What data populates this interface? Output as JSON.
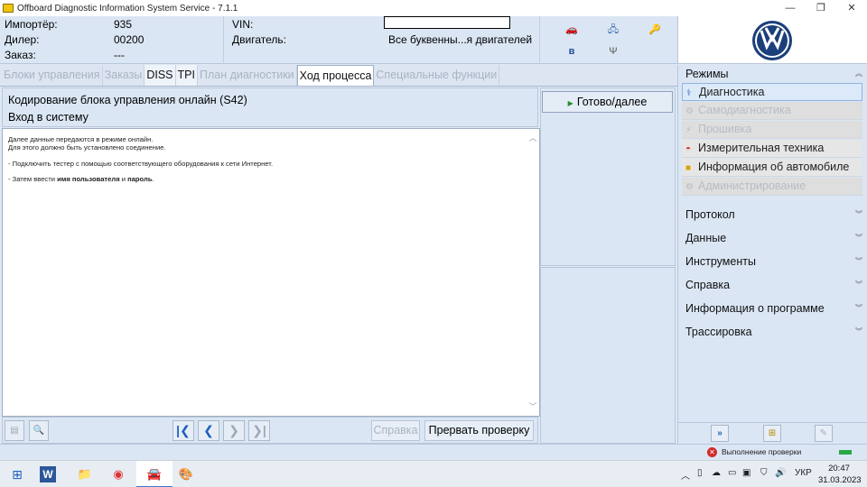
{
  "window": {
    "title": "Offboard Diagnostic Information System Service - 7.1.1",
    "min": "—",
    "max": "❐",
    "close": "✕"
  },
  "header": {
    "importer_label": "Импортёр:",
    "importer_value": "935",
    "dealer_label": "Дилер:",
    "dealer_value": "00200",
    "order_label": "Заказ:",
    "order_value": "---",
    "vin_label": "VIN:",
    "engine_label": "Двигатель:",
    "engine_value": "Все буквенны...я двигателей"
  },
  "tabs": [
    {
      "label": "Блоки управления",
      "state": "disabled"
    },
    {
      "label": "Заказы",
      "state": "disabled"
    },
    {
      "label": "DISS",
      "state": "active"
    },
    {
      "label": "TPI",
      "state": "active"
    },
    {
      "label": "План диагностики",
      "state": "disabled"
    },
    {
      "label": "Ход процесса",
      "state": "current"
    },
    {
      "label": "Специальные функции",
      "state": "disabled"
    }
  ],
  "main": {
    "heading": "Кодирование блока управления онлайн (S42)",
    "subheading": "Вход в систему",
    "content": {
      "line1": "Далее данные передаются в режиме онлайн.",
      "line2": "Для этого должно быть установлено соединение.",
      "line3": "- Подключить тестер с помощью соответствующего оборудования к сети Интернет.",
      "line4_prefix": "- Затем ввести ",
      "line4_bold1": "имя пользователя",
      "line4_mid": " и ",
      "line4_bold2": "пароль",
      "line4_suffix": "."
    },
    "help_label": "Справка",
    "abort_label": "Прервать проверку"
  },
  "mid": {
    "ready_label": "Готово/далее"
  },
  "sidebar": {
    "modes_label": "Режимы",
    "modes": [
      {
        "label": "Диагностика",
        "state": "selected",
        "icon": "stethoscope-icon"
      },
      {
        "label": "Самодиагностика",
        "state": "disabled",
        "icon": "self-diagnosis-icon"
      },
      {
        "label": "Прошивка",
        "state": "disabled",
        "icon": "flash-icon"
      },
      {
        "label": "Измерительная техника",
        "state": "enabled",
        "icon": "gauge-icon"
      },
      {
        "label": "Информация об автомобиле",
        "state": "enabled",
        "icon": "info-icon"
      },
      {
        "label": "Администрирование",
        "state": "disabled",
        "icon": "admin-icon"
      }
    ],
    "sections": [
      "Протокол",
      "Данные",
      "Инструменты",
      "Справка",
      "Информация о программе",
      "Трассировка"
    ]
  },
  "status": {
    "text": "Выполнение проверки",
    "color_ok": "#27a844",
    "color_err": "#d12a2a"
  },
  "taskbar": {
    "lang": "УКР",
    "time": "20:47",
    "date": "31.03.2023"
  },
  "colors": {
    "accent": "#3a78c8",
    "panel": "#dbe6f4"
  }
}
